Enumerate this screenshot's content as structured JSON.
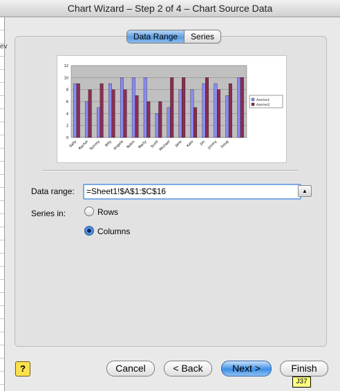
{
  "window": {
    "title": "Chart Wizard – Step 2 of 4 – Chart Source Data"
  },
  "background_sheet": {
    "partial_text": "ev"
  },
  "tabs": [
    {
      "label": "Data Range",
      "active": true
    },
    {
      "label": "Series",
      "active": false
    }
  ],
  "preview_chart": {
    "chart_data": {
      "type": "bar",
      "categories": [
        "Sally",
        "Rachel",
        "Tommy",
        "Billy",
        "Angela",
        "Robin",
        "Marty",
        "Scott",
        "Michael",
        "Jane",
        "Kate",
        "Jim",
        "Jimmy",
        "Doug"
      ],
      "series": [
        {
          "name": "Aseries1",
          "color": "#8b8bf0",
          "values": [
            9,
            6,
            5,
            9,
            10,
            10,
            10,
            4,
            5,
            8,
            8,
            9,
            9,
            7,
            10
          ]
        },
        {
          "name": "Aseries2",
          "color": "#8a2d52",
          "values": [
            9,
            8,
            9,
            8,
            8,
            7,
            6,
            6,
            10,
            10,
            5,
            10,
            8,
            9,
            10
          ]
        }
      ],
      "ylim": [
        0,
        12
      ],
      "yticks": [
        "0",
        "2",
        "4",
        "6",
        "8",
        "10",
        "12"
      ],
      "legend": "right",
      "grid": true
    }
  },
  "data_range": {
    "label": "Data range:",
    "value": "=Sheet1!$A$1:$C$16",
    "collapse_icon": "collapse-dialog-icon"
  },
  "series_in": {
    "label": "Series in:",
    "options": [
      {
        "label": "Rows",
        "selected": false
      },
      {
        "label": "Columns",
        "selected": true
      }
    ]
  },
  "buttons": {
    "help": "?",
    "cancel": "Cancel",
    "back": "< Back",
    "next": "Next >",
    "finish": "Finish"
  },
  "tooltip": "J37",
  "colors": {
    "accent": "#3f8ee5",
    "help": "#fbe14a"
  }
}
